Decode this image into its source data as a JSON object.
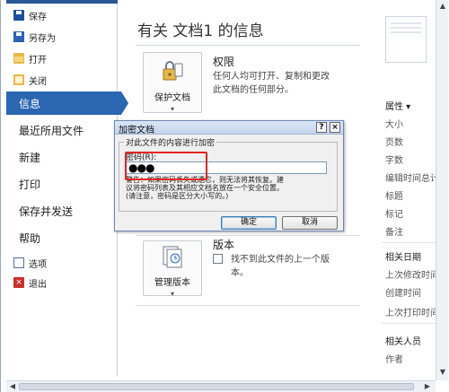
{
  "nav": {
    "save": "保存",
    "save_as": "另存为",
    "open": "打开",
    "close": "关闭",
    "info": "信息",
    "recent": "最近所用文件",
    "new": "新建",
    "print": "打印",
    "save_send": "保存并发送",
    "help": "帮助",
    "options": "选项",
    "exit": "退出",
    "accent_color": "#2b66b0"
  },
  "main": {
    "title": "有关 文档1 的信息",
    "permissions": {
      "button_label": "保护文档",
      "button_icon": "lock-key-icon",
      "title": "权限",
      "desc_line1": "任何人均可打开、复制和更改",
      "desc_line2": "此文档的任何部分。"
    },
    "versions": {
      "button_label": "管理版本",
      "button_icon": "versions-icon",
      "title": "版本",
      "desc_line1": "找不到此文件的上一个版",
      "desc_line2": "本。"
    }
  },
  "properties": {
    "header": "属性 ▾",
    "size": "大小",
    "pages": "页数",
    "words": "字数",
    "edit_time": "编辑时间总计",
    "title": "标题",
    "tags": "标记",
    "comments": "备注",
    "related_dates": "相关日期",
    "last_modified": "上次修改时间",
    "created": "创建时间",
    "last_printed": "上次打印时间",
    "related_people": "相关人员",
    "author": "作者"
  },
  "dialog": {
    "title": "加密文档",
    "help_btn": "?",
    "close_btn": "×",
    "group_label": "对此文件的内容进行加密",
    "field_label": "密码(R):",
    "password_mask": "●●●",
    "warning_line1": "警告：如果密码丢失或遗忘，则无法将其恢复。建",
    "warning_line2": "议将密码列表及其相应文档名放在一个安全位置。",
    "warning_line3": "(请注意，密码是区分大小写的。)",
    "ok": "确定",
    "cancel": "取消",
    "highlight_color": "#e52222"
  }
}
